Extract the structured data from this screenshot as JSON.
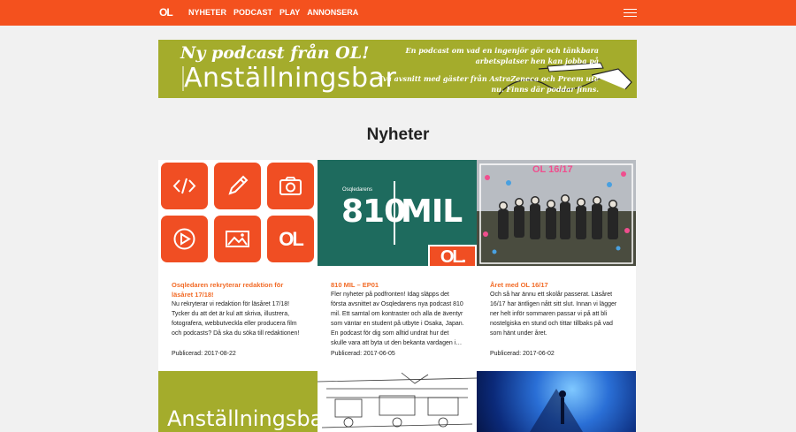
{
  "header": {
    "logo": "OL",
    "nav": [
      "NYHETER",
      "PODCAST",
      "PLAY",
      "ANNONSERA"
    ]
  },
  "banner": {
    "line1": "Ny podcast från OL!",
    "line2": "Anställningsbar",
    "line3": "En podcast om vad en ingenjör gör och tänkbara arbetsplatser hen kan jobba på",
    "line4": "Två avsnitt med gäster från AstraZeneca och Preem ute nu. Finns där poddar finns."
  },
  "page": {
    "heading": "Nyheter"
  },
  "cards": [
    {
      "title": "Osqledaren rekryterar redaktion för läsåret 17/18!",
      "excerpt": "Nu rekryterar vi redaktion för läsåret 17/18! Tycker du att det är kul att skriva, illustrera, fotografera, webbutveckla eller producera film och podcasts? Då ska du söka till redaktionen!",
      "date": "Publicerad: 2017-08-22",
      "tile_logo": "OL"
    },
    {
      "title": "810 MIL – EP01",
      "excerpt": "Fler nyheter på podfronten! Idag släpps det första avsnittet av Osqledarens nya podcast 810 mil. Ett samtal om kontraster och alla de äventyr som väntar en student på utbyte i Osaka, Japan. En podcast för dig som alltid undrat hur det skulle vara att byta ut den bekanta vardagen i…",
      "date": "Publicerad: 2017-06-05",
      "img_small": "Osqledarens",
      "img_left": "810",
      "img_right": "MIL",
      "img_logo": "OL."
    },
    {
      "title": "Året med OL 16/17",
      "excerpt": "Och så har ännu ett skolår passerat. Läsåret 16/17 har äntligen nått sitt slut. Innan vi lägger ner helt inför sommaren passar vi på att bli nostelgiska en stund och tittar tillbaks på vad som hänt under året.",
      "date": "Publicerad: 2017-06-02",
      "img_label": "OL 16/17"
    }
  ],
  "bottom": {
    "banner_text": "Anställningsbar"
  },
  "colors": {
    "accent": "#f4511e",
    "olive": "#a4ac2c",
    "teal": "#1e6b5e",
    "orange_text": "#f26b27"
  }
}
